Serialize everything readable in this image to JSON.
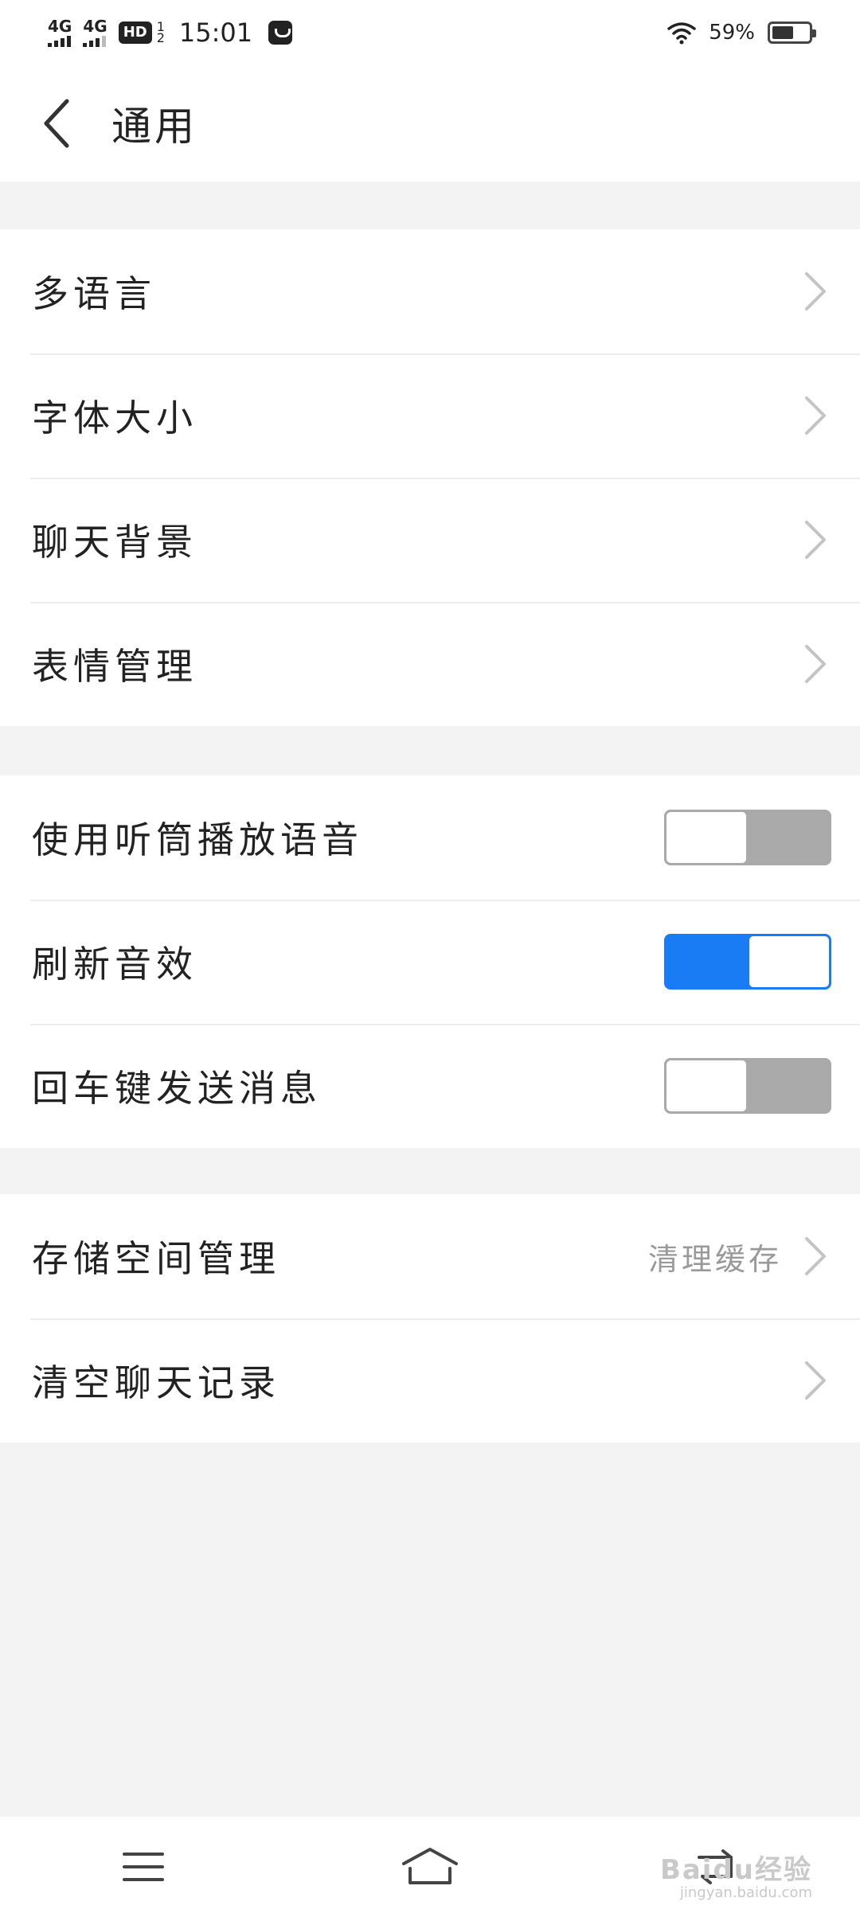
{
  "status_bar": {
    "network1": "4G",
    "network2": "4G",
    "hd_label": "HD",
    "hd_sub_top": "1",
    "hd_sub_bottom": "2",
    "time": "15:01",
    "battery_percent": "59%",
    "battery_level": 0.59
  },
  "header": {
    "title": "通用"
  },
  "section1": {
    "items": [
      {
        "label": "多语言"
      },
      {
        "label": "字体大小"
      },
      {
        "label": "聊天背景"
      },
      {
        "label": "表情管理"
      }
    ]
  },
  "section2": {
    "items": [
      {
        "label": "使用听筒播放语音",
        "enabled": false
      },
      {
        "label": "刷新音效",
        "enabled": true
      },
      {
        "label": "回车键发送消息",
        "enabled": false
      }
    ]
  },
  "section3": {
    "items": [
      {
        "label": "存储空间管理",
        "value": "清理缓存"
      },
      {
        "label": "清空聊天记录"
      }
    ]
  },
  "watermark": {
    "brand": "Baidu经验",
    "url": "jingyan.baidu.com"
  },
  "colors": {
    "accent": "#1a7cf5",
    "toggle_off": "#a9aaa9",
    "divider": "#ececec",
    "background": "#f3f3f3"
  }
}
